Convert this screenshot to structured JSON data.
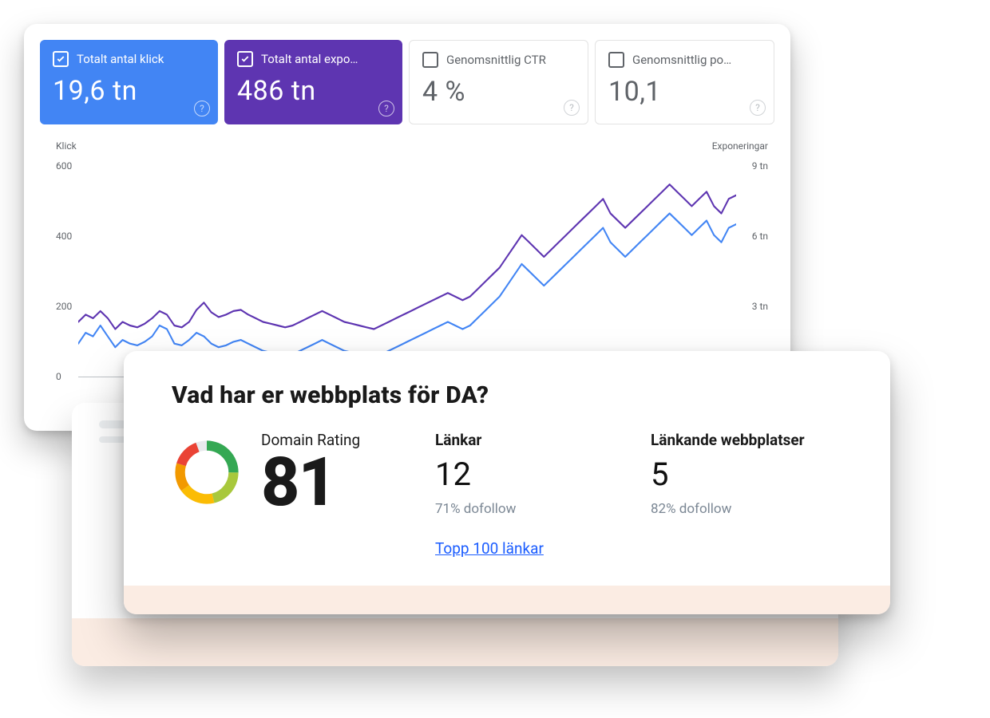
{
  "tiles": [
    {
      "label": "Totalt antal klick",
      "value": "19,6 tn",
      "active": true,
      "color": "blue"
    },
    {
      "label": "Totalt antal expo…",
      "value": "486 tn",
      "active": true,
      "color": "purple"
    },
    {
      "label": "Genomsnittlig CTR",
      "value": "4 %",
      "active": false
    },
    {
      "label": "Genomsnittlig po…",
      "value": "10,1",
      "active": false
    }
  ],
  "chart_axes": {
    "left_title": "Klick",
    "right_title": "Exponeringar",
    "left_ticks": [
      "600",
      "400",
      "200",
      "0"
    ],
    "right_ticks": [
      "9 tn",
      "6 tn",
      "3 tn"
    ]
  },
  "da": {
    "title": "Vad har er webbplats för DA?",
    "dr_label": "Domain Rating",
    "dr_value": "81",
    "links_label": "Länkar",
    "links_value": "12",
    "links_sub": "71% dofollow",
    "linking_label": "Länkande webbplatser",
    "linking_value": "5",
    "linking_sub": "82% dofollow",
    "top_link": "Topp 100 länkar"
  },
  "chart_data": {
    "type": "line",
    "title": "",
    "xlabel": "",
    "ylabel_left": "Klick",
    "ylabel_right": "Exponeringar",
    "ylim_left": [
      0,
      600
    ],
    "ylim_right": [
      0,
      9000
    ],
    "x": [
      0,
      1,
      2,
      3,
      4,
      5,
      6,
      7,
      8,
      9,
      10,
      11,
      12,
      13,
      14,
      15,
      16,
      17,
      18,
      19,
      20,
      21,
      22,
      23,
      24,
      25,
      26,
      27,
      28,
      29,
      30,
      31,
      32,
      33,
      34,
      35,
      36,
      37,
      38,
      39,
      40,
      41,
      42,
      43,
      44,
      45,
      46,
      47,
      48,
      49,
      50,
      51,
      52,
      53,
      54,
      55,
      56,
      57,
      58,
      59,
      60,
      61,
      62,
      63,
      64,
      65,
      66,
      67,
      68,
      69,
      70,
      71,
      72,
      73,
      74,
      75,
      76,
      77,
      78,
      79,
      80,
      81,
      82,
      83,
      84,
      85,
      86,
      87,
      88,
      89
    ],
    "series": [
      {
        "name": "Klick",
        "axis": "left",
        "color": "#4285F4",
        "values": [
          100,
          130,
          120,
          150,
          120,
          90,
          110,
          100,
          95,
          105,
          120,
          150,
          140,
          100,
          95,
          110,
          130,
          120,
          100,
          90,
          95,
          105,
          110,
          100,
          90,
          80,
          75,
          70,
          65,
          70,
          80,
          90,
          100,
          110,
          100,
          90,
          80,
          75,
          70,
          65,
          60,
          70,
          80,
          90,
          100,
          110,
          120,
          130,
          140,
          150,
          160,
          150,
          140,
          150,
          170,
          190,
          210,
          230,
          260,
          290,
          320,
          300,
          280,
          260,
          280,
          300,
          320,
          340,
          360,
          380,
          400,
          420,
          380,
          360,
          340,
          360,
          380,
          400,
          420,
          440,
          460,
          440,
          420,
          400,
          420,
          440,
          400,
          380,
          420,
          430
        ]
      },
      {
        "name": "Exponeringar",
        "axis": "right",
        "color": "#5E35B1",
        "values": [
          2400,
          2700,
          2550,
          2850,
          2550,
          2100,
          2400,
          2250,
          2175,
          2325,
          2550,
          2850,
          2700,
          2250,
          2175,
          2400,
          2900,
          3200,
          2800,
          2600,
          2700,
          2850,
          2900,
          2700,
          2550,
          2400,
          2325,
          2250,
          2175,
          2250,
          2400,
          2550,
          2700,
          2850,
          2700,
          2550,
          2400,
          2325,
          2250,
          2175,
          2100,
          2250,
          2400,
          2550,
          2700,
          2850,
          3000,
          3150,
          3300,
          3450,
          3600,
          3450,
          3300,
          3450,
          3750,
          4050,
          4350,
          4650,
          5100,
          5550,
          6000,
          5700,
          5400,
          5100,
          5400,
          5700,
          6000,
          6300,
          6600,
          6900,
          7200,
          7500,
          6900,
          6600,
          6300,
          6600,
          6900,
          7200,
          7500,
          7800,
          8100,
          7800,
          7500,
          7200,
          7500,
          7800,
          7200,
          6900,
          7500,
          7650
        ]
      }
    ]
  }
}
